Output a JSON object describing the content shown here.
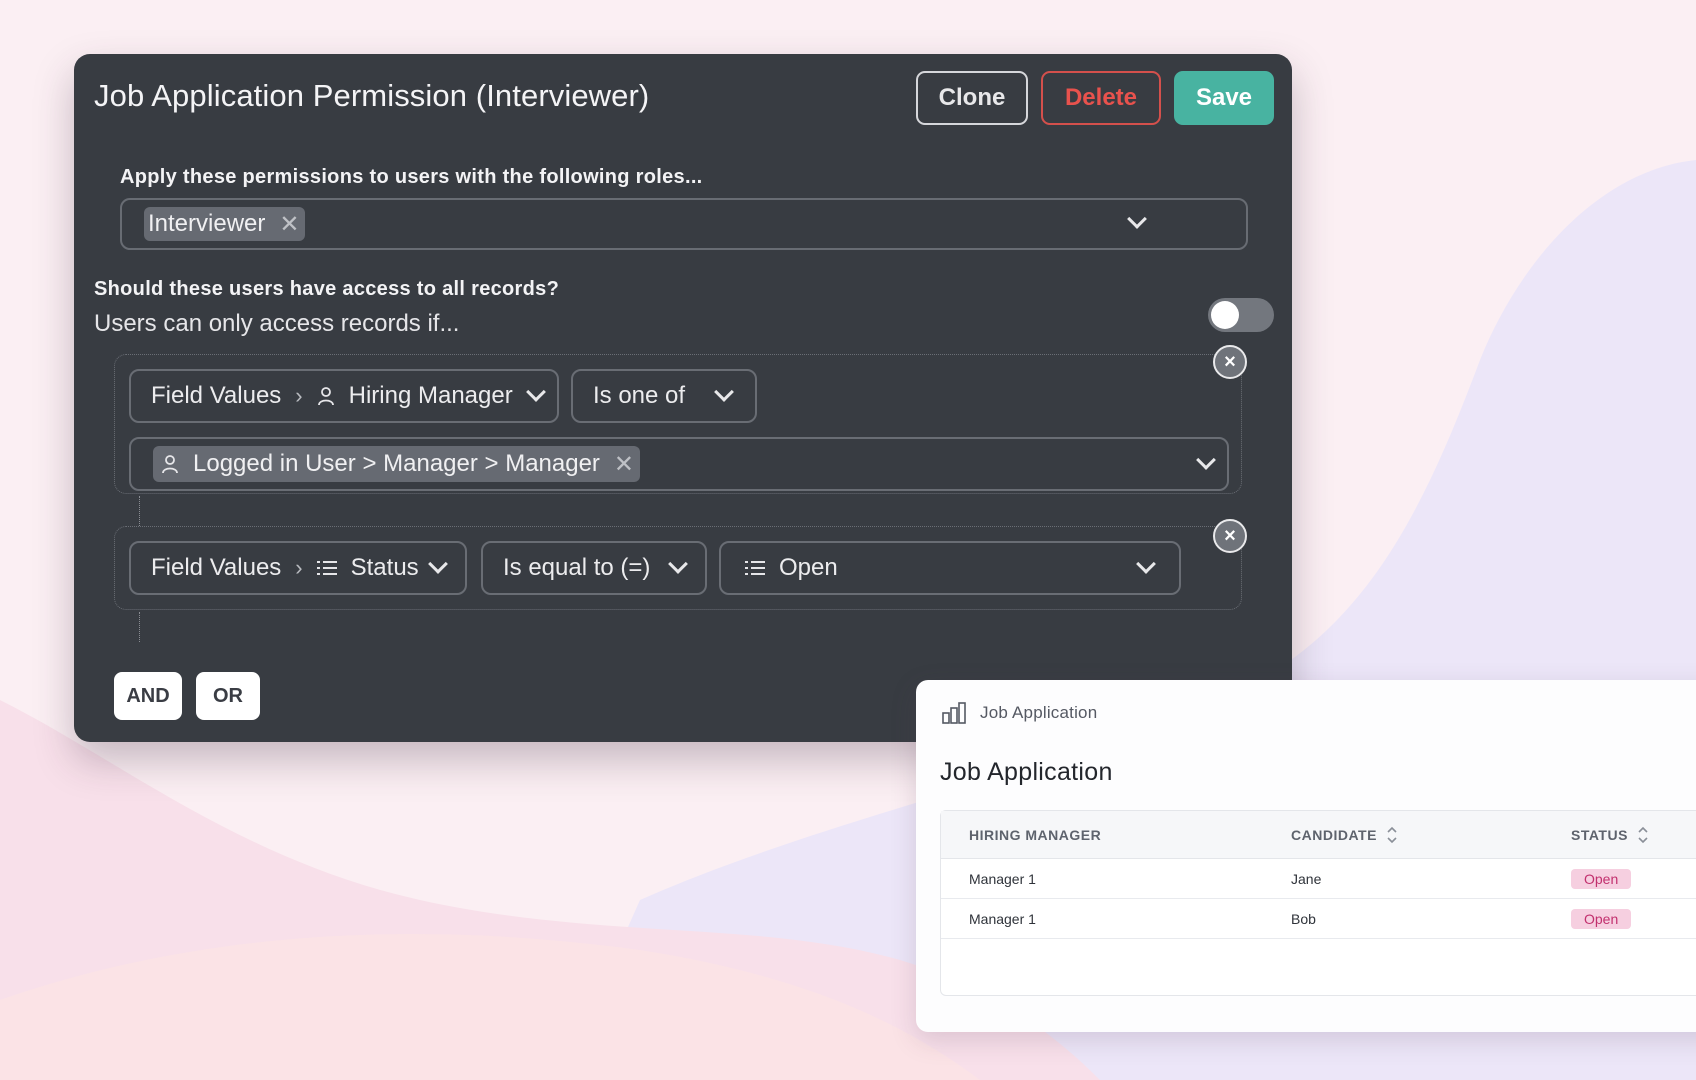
{
  "panel": {
    "title": "Job Application Permission (Interviewer)",
    "buttons": {
      "clone": "Clone",
      "delete": "Delete",
      "save": "Save"
    },
    "roles_label": "Apply these permissions to users with the following roles...",
    "roles": [
      "Interviewer"
    ],
    "access_all_label": "Should these users have access to all records?",
    "access_all_enabled": false,
    "condition_intro": "Users can only access records if...",
    "conditions": [
      {
        "field_prefix": "Field Values",
        "field": "Hiring Manager",
        "field_icon": "person-icon",
        "operator": "Is one of",
        "values": [
          "Logged in User > Manager > Manager"
        ],
        "value_icon": "person-icon"
      },
      {
        "field_prefix": "Field Values",
        "field": "Status",
        "field_icon": "list-icon",
        "operator": "Is equal to (=)",
        "value": "Open",
        "value_icon": "list-icon"
      }
    ],
    "logic_buttons": {
      "and": "AND",
      "or": "OR"
    }
  },
  "table_card": {
    "breadcrumb": "Job Application",
    "breadcrumb_icon": "bar-chart-icon",
    "title": "Job Application",
    "columns": [
      "HIRING MANAGER",
      "CANDIDATE",
      "STATUS"
    ],
    "rows": [
      {
        "hiring_manager": "Manager 1",
        "candidate": "Jane",
        "status": "Open"
      },
      {
        "hiring_manager": "Manager 1",
        "candidate": "Bob",
        "status": "Open"
      }
    ],
    "status_color": "#c2306e"
  },
  "colors": {
    "panel_bg": "#383c42",
    "save": "#48b3a1",
    "delete": "#e8524d"
  }
}
